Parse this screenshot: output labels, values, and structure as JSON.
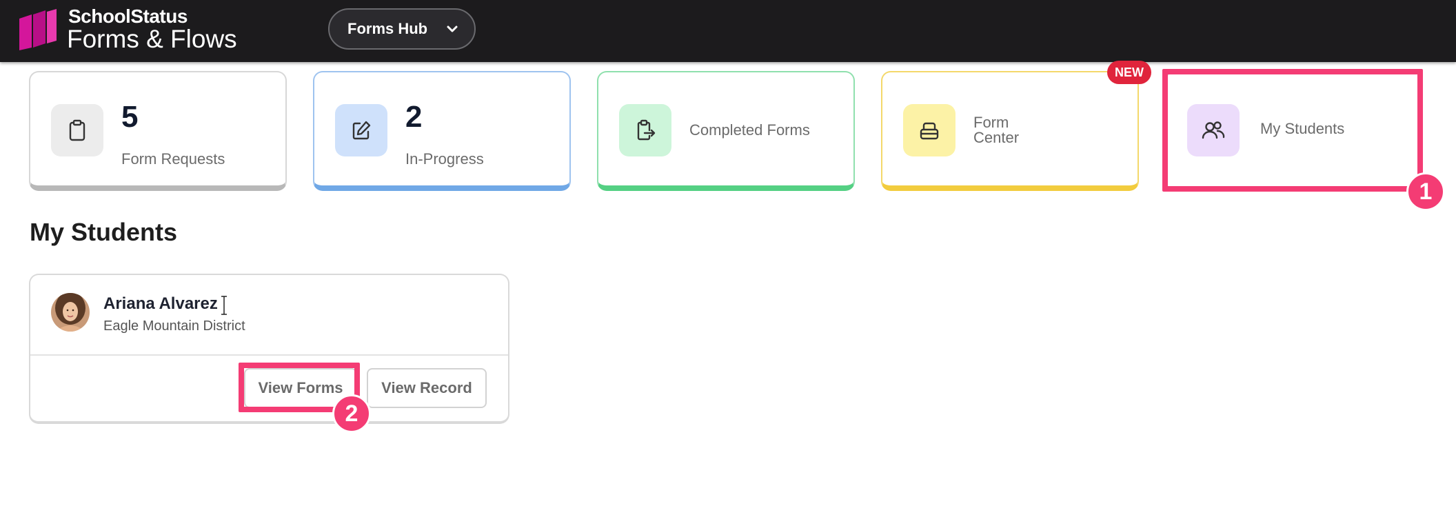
{
  "header": {
    "brand_top": "SchoolStatus",
    "brand_bottom": "Forms & Flows",
    "hub_label": "Forms Hub"
  },
  "stats": [
    {
      "count": "5",
      "label": "Form Requests",
      "icon": "clipboard-icon"
    },
    {
      "count": "2",
      "label": "In-Progress",
      "icon": "edit-icon"
    },
    {
      "label": "Completed Forms",
      "icon": "clipboard-export-icon"
    },
    {
      "label_line1": "Form",
      "label_line2": "Center",
      "badge": "NEW",
      "icon": "inbox-stack-icon"
    },
    {
      "label": "My Students",
      "icon": "users-icon"
    }
  ],
  "section": {
    "title": "My Students"
  },
  "student": {
    "name": "Ariana Alvarez",
    "district": "Eagle Mountain District",
    "view_forms": "View Forms",
    "view_record": "View Record"
  },
  "annotations": {
    "marker1": "1",
    "marker2": "2"
  },
  "colors": {
    "header_bg": "#1c1b1d",
    "highlight": "#f43c74",
    "badge": "#e0243c",
    "brand_magenta": "#c2128f"
  }
}
